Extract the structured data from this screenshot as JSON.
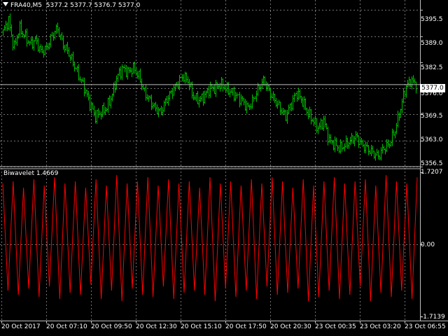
{
  "header": {
    "symbol": "FRA40,M5",
    "ohlc": "5377.2 5377.7 5376.7 5377.0",
    "current_price": "5377.0"
  },
  "price_axis": {
    "labels": [
      "5395.5",
      "5389.0",
      "5382.5",
      "5376.0",
      "5369.5",
      "5363.0",
      "5356.5"
    ]
  },
  "indicator": {
    "title": "Biwavelet 1.4669",
    "axis_labels": [
      "1.7207",
      "0.00",
      "-1.7139"
    ]
  },
  "time_axis": {
    "labels": [
      "20 Oct 2017",
      "20 Oct 07:10",
      "20 Oct 09:50",
      "20 Oct 12:30",
      "20 Oct 15:10",
      "20 Oct 17:50",
      "20 Oct 20:30",
      "23 Oct 00:35",
      "23 Oct 03:20",
      "23 Oct 06:55"
    ]
  },
  "colors": {
    "background": "#000000",
    "grid": "#c0c0c0",
    "price_bars": "#00c000",
    "indicator_line": "#ff0000",
    "text": "#ffffff"
  },
  "chart_data": [
    {
      "type": "line",
      "title": "FRA40,M5",
      "x_range": [
        "20 Oct 2017",
        "23 Oct 06:55"
      ],
      "ylim": [
        5356.5,
        5398.0
      ],
      "series": [
        {
          "values": [
            5390,
            5393,
            5386,
            5391,
            5389,
            5387,
            5388,
            5385,
            5386,
            5389,
            5391,
            5387,
            5385,
            5382,
            5379,
            5376,
            5372,
            5369,
            5370,
            5371,
            5374,
            5379,
            5381,
            5380,
            5381,
            5379,
            5375,
            5373,
            5371,
            5370,
            5373,
            5375,
            5377,
            5379,
            5378,
            5374,
            5373,
            5374,
            5376,
            5376,
            5377,
            5376,
            5375,
            5374,
            5373,
            5371,
            5373,
            5376,
            5378,
            5375,
            5373,
            5371,
            5369,
            5372,
            5375,
            5373,
            5370,
            5368,
            5366,
            5368,
            5363,
            5362,
            5361,
            5362,
            5363,
            5364,
            5362,
            5361,
            5360,
            5359,
            5361,
            5362,
            5365,
            5370,
            5376,
            5378,
            5377
          ]
        }
      ]
    },
    {
      "type": "line",
      "title": "Biwavelet 1.4669",
      "ylim": [
        -1.7139,
        1.7207
      ],
      "series": [
        {
          "name": "Biwavelet",
          "values": [
            1.45,
            -1.1,
            1.5,
            -1.2,
            1.35,
            -1.05,
            1.55,
            -1.25,
            1.4,
            -1.0,
            1.6,
            -1.3,
            1.45,
            -1.15,
            1.5,
            -1.2,
            1.35,
            -0.95,
            1.55,
            -1.3,
            1.4,
            -1.1,
            1.65,
            -1.35,
            1.45,
            -1.05,
            1.5,
            -1.2,
            1.6,
            -1.25,
            1.4,
            -1.0,
            1.55,
            -1.3,
            1.45,
            -1.15,
            1.5,
            -1.1,
            1.35,
            -1.2,
            1.6,
            -1.35,
            1.45,
            -1.05,
            1.5,
            -1.25,
            1.4,
            -1.1,
            1.55,
            -1.3,
            1.45,
            -1.0,
            1.6,
            -1.2,
            1.5,
            -1.15,
            1.35,
            -1.05,
            1.55,
            -1.35,
            1.4,
            -1.25,
            1.5,
            -1.1,
            1.6,
            -1.3,
            1.45,
            -1.2,
            1.5,
            -1.0,
            1.55,
            -1.35,
            1.4,
            -1.15,
            1.65,
            -1.25,
            1.5,
            -1.1,
            1.45,
            -1.3,
            1.6
          ]
        }
      ]
    }
  ]
}
